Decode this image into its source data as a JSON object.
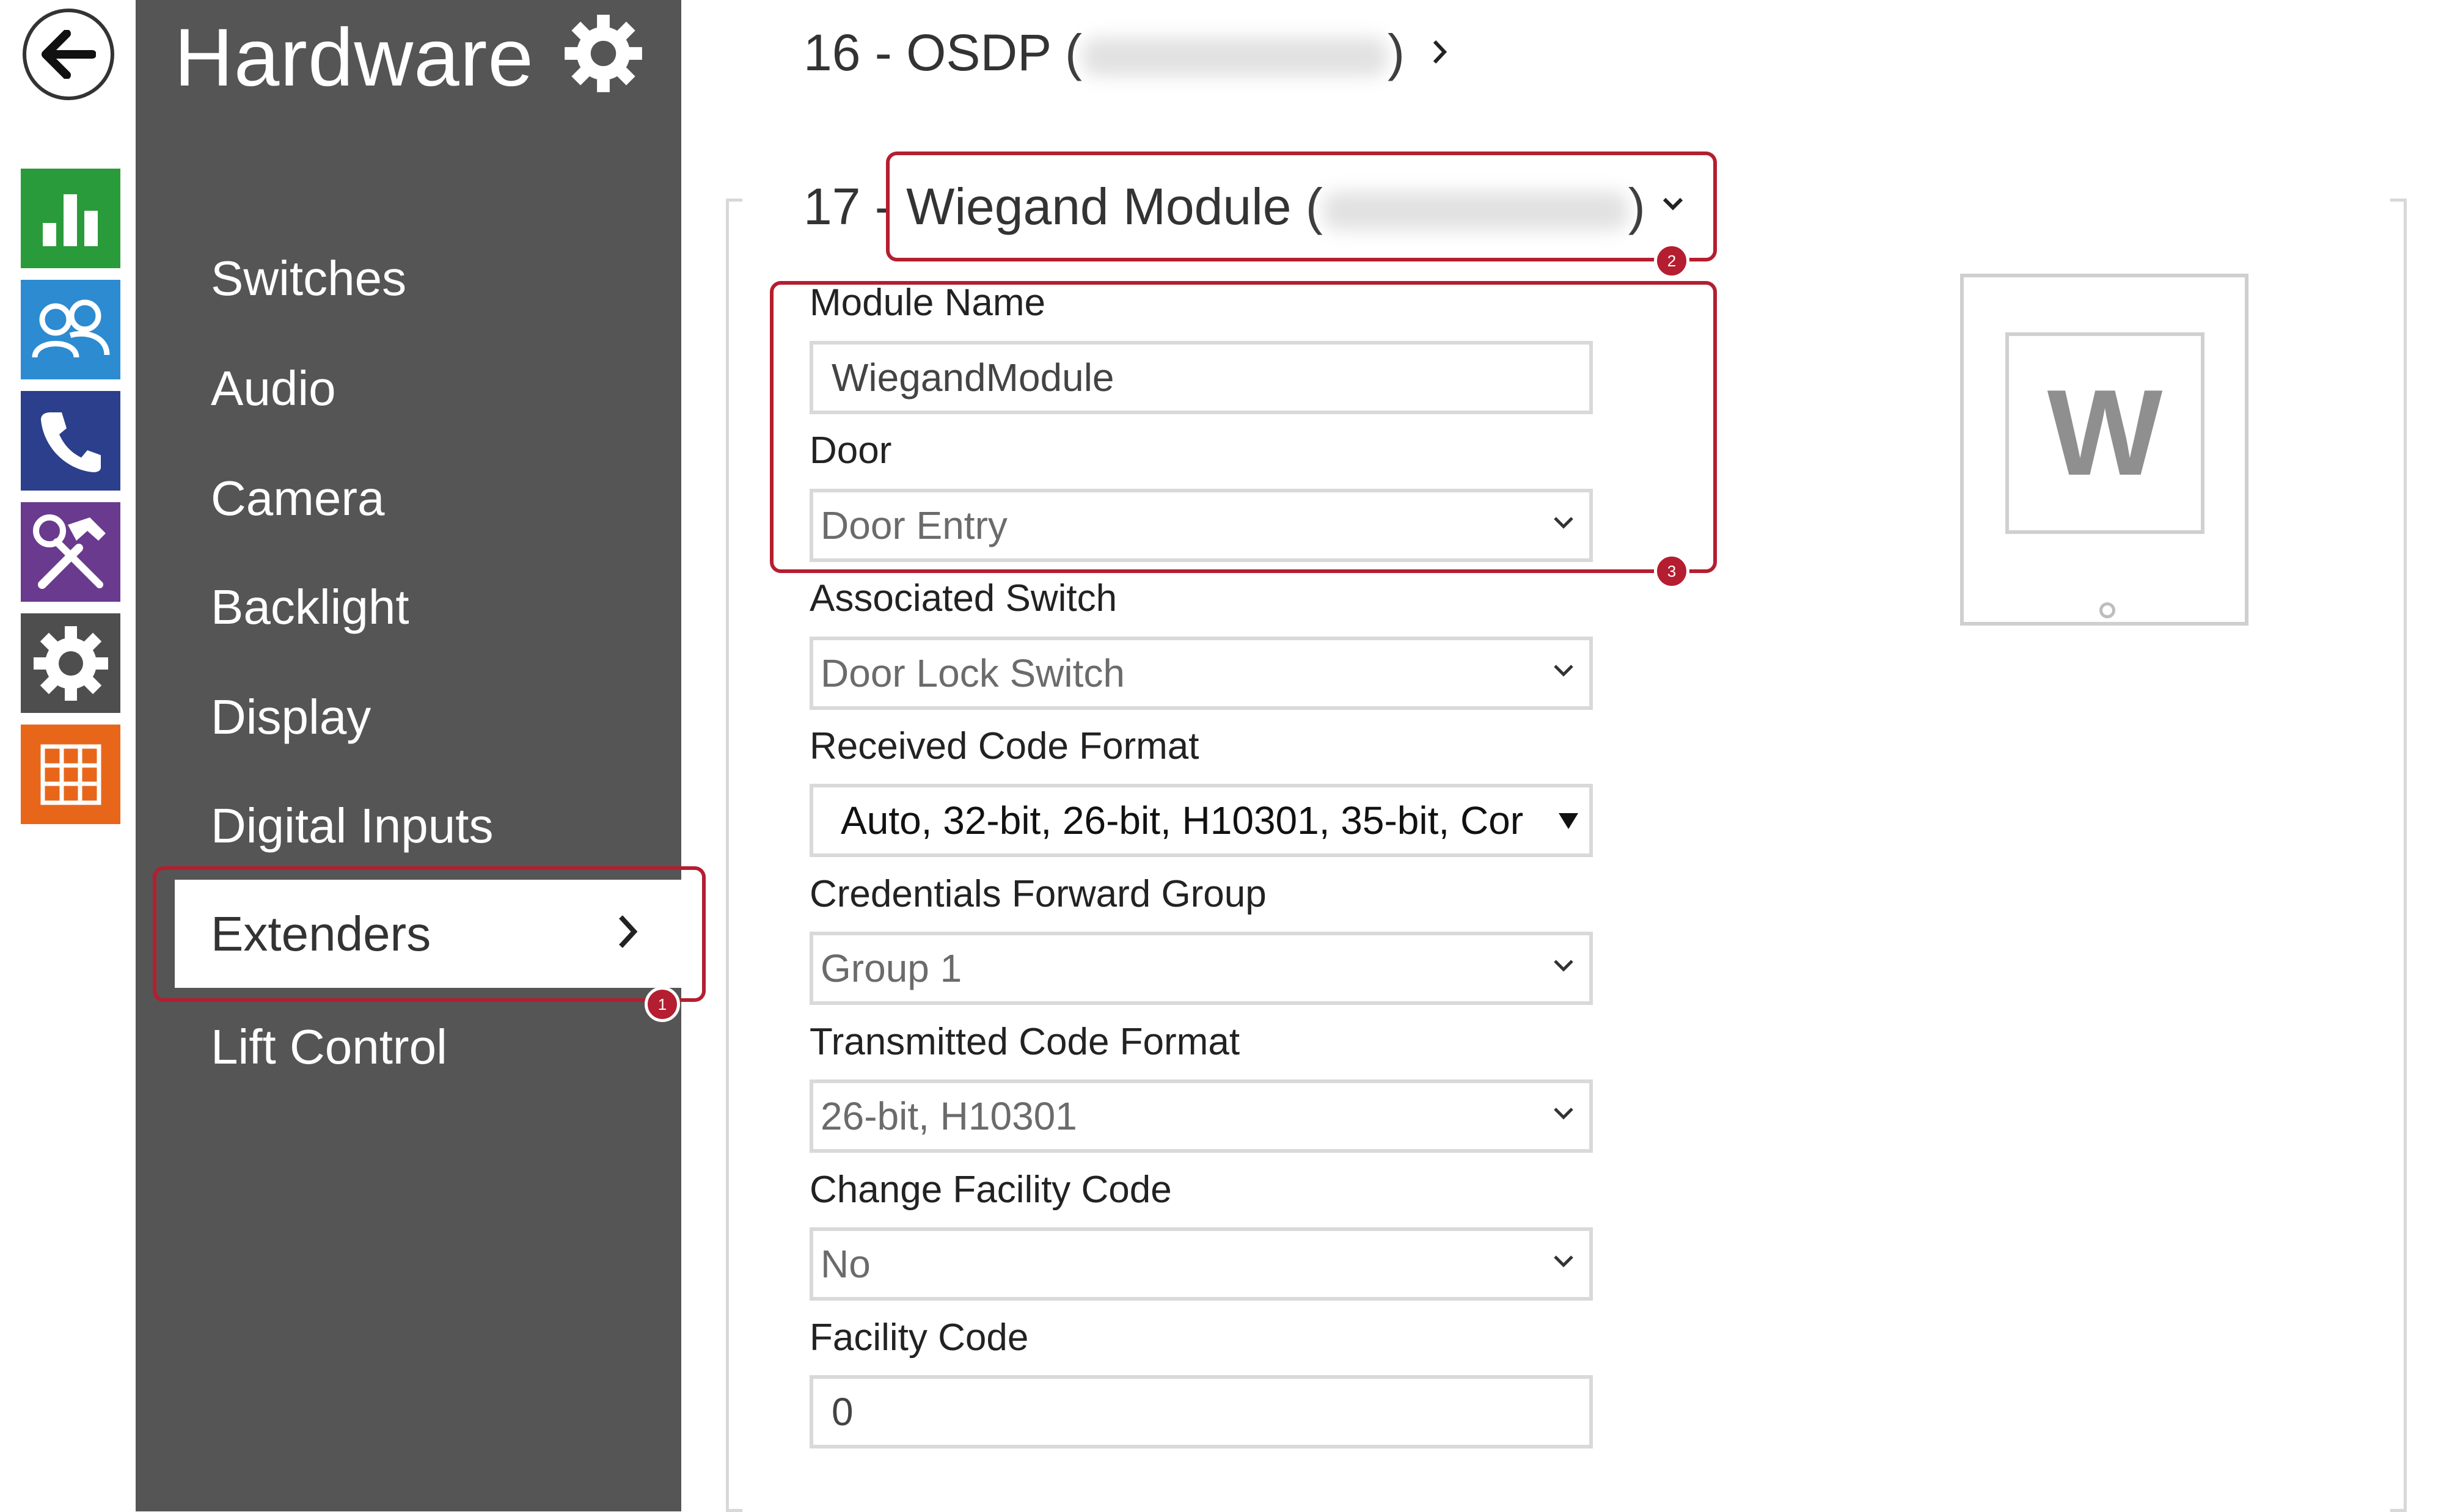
{
  "header": {
    "title": "Hardware"
  },
  "rail": {
    "items": [
      {
        "name": "status-icon",
        "color": "#2a9b3a"
      },
      {
        "name": "directory-icon",
        "color": "#2c8bd1"
      },
      {
        "name": "phone-icon",
        "color": "#2b3f8c"
      },
      {
        "name": "tools-icon",
        "color": "#6a3a8e"
      },
      {
        "name": "gear-icon",
        "color": "#4e4e4e"
      },
      {
        "name": "apps-icon",
        "color": "#e8661a"
      }
    ]
  },
  "sidebar": {
    "items": [
      {
        "label": "Switches"
      },
      {
        "label": "Audio"
      },
      {
        "label": "Camera"
      },
      {
        "label": "Backlight"
      },
      {
        "label": "Display"
      },
      {
        "label": "Digital Inputs"
      },
      {
        "label": "Extenders",
        "active": true
      },
      {
        "label": "Lift Control"
      }
    ]
  },
  "modules": [
    {
      "index": "16",
      "name": "OSDP",
      "state": "collapsed"
    },
    {
      "index": "17",
      "name": "Wiegand Module",
      "state": "expanded"
    }
  ],
  "badges": [
    "1",
    "2",
    "3"
  ],
  "form": {
    "module_name": {
      "label": "Module Name",
      "value": "WiegandModule"
    },
    "door": {
      "label": "Door",
      "value": "Door Entry"
    },
    "associated_switch": {
      "label": "Associated Switch",
      "value": "Door Lock Switch"
    },
    "received_code_format": {
      "label": "Received Code Format",
      "value": "Auto, 32-bit, 26-bit, H10301, 35-bit, Cor"
    },
    "credentials_forward_group": {
      "label": "Credentials Forward Group",
      "value": "Group 1"
    },
    "transmitted_code_format": {
      "label": "Transmitted Code Format",
      "value": "26-bit, H10301"
    },
    "change_facility_code": {
      "label": "Change Facility Code",
      "value": "No"
    },
    "facility_code": {
      "label": "Facility Code",
      "value": "0"
    }
  },
  "preview": {
    "letter": "W"
  },
  "colors": {
    "highlight": "#b41e30",
    "sidebar": "#555555"
  }
}
